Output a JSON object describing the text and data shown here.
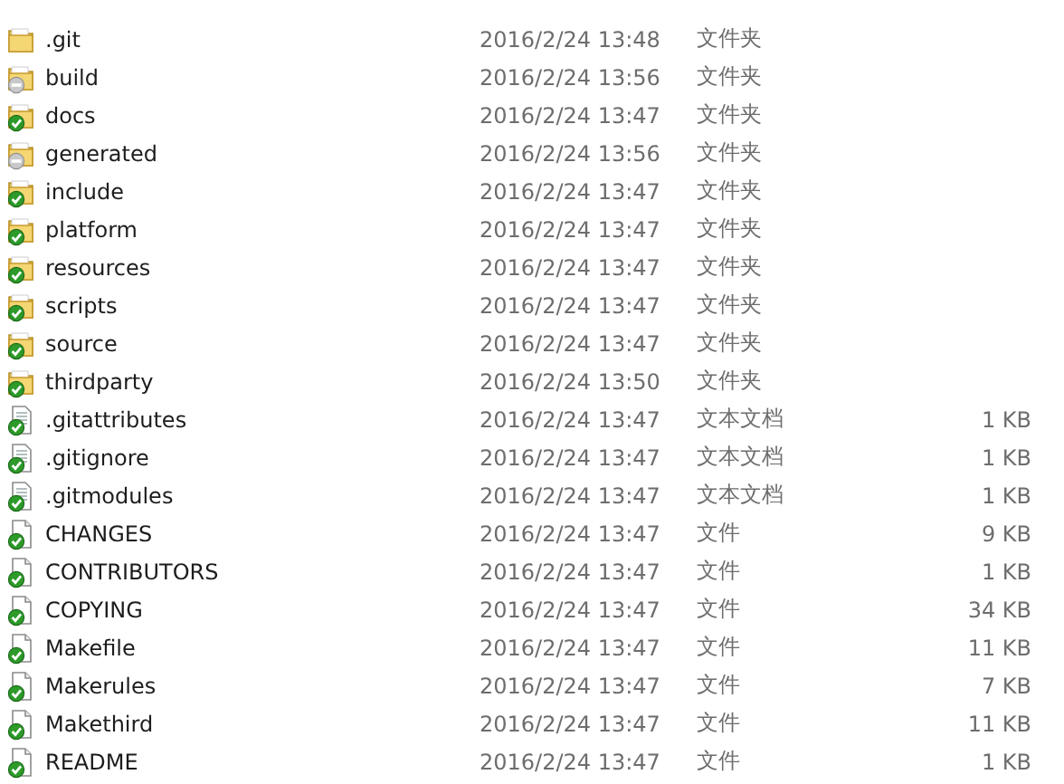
{
  "files": [
    {
      "name": ".git",
      "modified": "2016/2/24 13:48",
      "type": "文件夹",
      "kind": "folder",
      "committed": false,
      "ignored": false
    },
    {
      "name": "build",
      "modified": "2016/2/24 13:56",
      "type": "文件夹",
      "kind": "folder",
      "committed": false,
      "ignored": true
    },
    {
      "name": "docs",
      "modified": "2016/2/24 13:47",
      "type": "文件夹",
      "kind": "folder",
      "committed": true,
      "ignored": false
    },
    {
      "name": "generated",
      "modified": "2016/2/24 13:56",
      "type": "文件夹",
      "kind": "folder",
      "committed": false,
      "ignored": true
    },
    {
      "name": "include",
      "modified": "2016/2/24 13:47",
      "type": "文件夹",
      "kind": "folder",
      "committed": true,
      "ignored": false
    },
    {
      "name": "platform",
      "modified": "2016/2/24 13:47",
      "type": "文件夹",
      "kind": "folder",
      "committed": true,
      "ignored": false
    },
    {
      "name": "resources",
      "modified": "2016/2/24 13:47",
      "type": "文件夹",
      "kind": "folder",
      "committed": true,
      "ignored": false
    },
    {
      "name": "scripts",
      "modified": "2016/2/24 13:47",
      "type": "文件夹",
      "kind": "folder",
      "committed": true,
      "ignored": false
    },
    {
      "name": "source",
      "modified": "2016/2/24 13:47",
      "type": "文件夹",
      "kind": "folder",
      "committed": true,
      "ignored": false
    },
    {
      "name": "thirdparty",
      "modified": "2016/2/24 13:50",
      "type": "文件夹",
      "kind": "folder",
      "committed": true,
      "ignored": false
    },
    {
      "name": ".gitattributes",
      "modified": "2016/2/24 13:47",
      "type": "文本文档",
      "size": "1 KB",
      "kind": "text",
      "committed": true,
      "ignored": false
    },
    {
      "name": ".gitignore",
      "modified": "2016/2/24 13:47",
      "type": "文本文档",
      "size": "1 KB",
      "kind": "text",
      "committed": true,
      "ignored": false
    },
    {
      "name": ".gitmodules",
      "modified": "2016/2/24 13:47",
      "type": "文本文档",
      "size": "1 KB",
      "kind": "text",
      "committed": true,
      "ignored": false
    },
    {
      "name": "CHANGES",
      "modified": "2016/2/24 13:47",
      "type": "文件",
      "size": "9 KB",
      "kind": "file",
      "committed": true,
      "ignored": false
    },
    {
      "name": "CONTRIBUTORS",
      "modified": "2016/2/24 13:47",
      "type": "文件",
      "size": "1 KB",
      "kind": "file",
      "committed": true,
      "ignored": false
    },
    {
      "name": "COPYING",
      "modified": "2016/2/24 13:47",
      "type": "文件",
      "size": "34 KB",
      "kind": "file",
      "committed": true,
      "ignored": false
    },
    {
      "name": "Makefile",
      "modified": "2016/2/24 13:47",
      "type": "文件",
      "size": "11 KB",
      "kind": "file",
      "committed": true,
      "ignored": false
    },
    {
      "name": "Makerules",
      "modified": "2016/2/24 13:47",
      "type": "文件",
      "size": "7 KB",
      "kind": "file",
      "committed": true,
      "ignored": false
    },
    {
      "name": "Makethird",
      "modified": "2016/2/24 13:47",
      "type": "文件",
      "size": "11 KB",
      "kind": "file",
      "committed": true,
      "ignored": false
    },
    {
      "name": "README",
      "modified": "2016/2/24 13:47",
      "type": "文件",
      "size": "1 KB",
      "kind": "file",
      "committed": true,
      "ignored": false
    }
  ]
}
